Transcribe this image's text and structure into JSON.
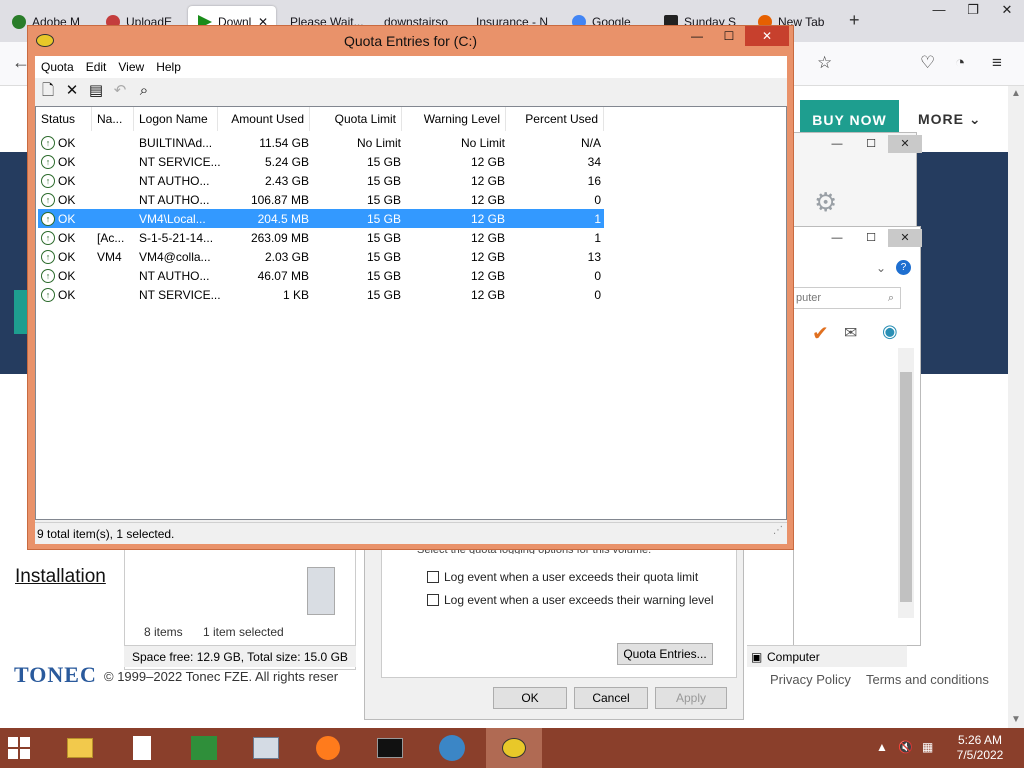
{
  "browser": {
    "tabs": [
      {
        "label": "Adobe M",
        "color": "#2a7d2a"
      },
      {
        "label": "UploadE",
        "color": "#c43d3d"
      },
      {
        "label": "Downl",
        "color": "#1a8c1a"
      },
      {
        "label": "Please Wait...",
        "color": "#9aa"
      },
      {
        "label": "downstairso",
        "color": "#9aa"
      },
      {
        "label": "Insurance - N",
        "color": "#9aa"
      },
      {
        "label": "Google",
        "color": "#4285f4"
      },
      {
        "label": "Sunday S",
        "color": "#222"
      },
      {
        "label": "New Tab",
        "color": "#e66000"
      }
    ],
    "new_tab_icon": "plus-icon"
  },
  "web": {
    "buy_now": "BUY NOW",
    "more": "MORE",
    "installation": "Installation",
    "brand": "TONEC",
    "copyright": "© 1999–2022 Tonec FZE. All rights reser",
    "privacy": "Privacy Policy",
    "terms": "Terms and conditions"
  },
  "explorer": {
    "items_count": "8 items",
    "selected": "1 item selected",
    "space": "Space free: 12.9 GB, Total size: 15.0 GB"
  },
  "properties": {
    "logging_caption": "Select the quota logging options for this volume:",
    "log_limit": "Log event when a user exceeds their quota limit",
    "log_warning": "Log event when a user exceeds their warning level",
    "quota_entries_button": "Quota Entries...",
    "ok": "OK",
    "cancel": "Cancel",
    "apply": "Apply"
  },
  "right_window": {
    "search_placeholder": "puter",
    "computer": "Computer"
  },
  "quota": {
    "title": "Quota Entries for  (C:)",
    "menu": [
      "Quota",
      "Edit",
      "View",
      "Help"
    ],
    "columns": [
      "Status",
      "Na...",
      "Logon Name",
      "Amount Used",
      "Quota Limit",
      "Warning Level",
      "Percent Used"
    ],
    "rows": [
      {
        "status": "OK",
        "name": "",
        "logon": "BUILTIN\\Ad...",
        "used": "11.54 GB",
        "limit": "No Limit",
        "warning": "No Limit",
        "percent": "N/A"
      },
      {
        "status": "OK",
        "name": "",
        "logon": "NT SERVICE...",
        "used": "5.24 GB",
        "limit": "15 GB",
        "warning": "12 GB",
        "percent": "34"
      },
      {
        "status": "OK",
        "name": "",
        "logon": "NT AUTHO...",
        "used": "2.43 GB",
        "limit": "15 GB",
        "warning": "12 GB",
        "percent": "16"
      },
      {
        "status": "OK",
        "name": "",
        "logon": "NT AUTHO...",
        "used": "106.87 MB",
        "limit": "15 GB",
        "warning": "12 GB",
        "percent": "0"
      },
      {
        "status": "OK",
        "name": "",
        "logon": "VM4\\Local...",
        "used": "204.5 MB",
        "limit": "15 GB",
        "warning": "12 GB",
        "percent": "1",
        "selected": true
      },
      {
        "status": "OK",
        "name": "[Ac...",
        "logon": "S-1-5-21-14...",
        "used": "263.09 MB",
        "limit": "15 GB",
        "warning": "12 GB",
        "percent": "1"
      },
      {
        "status": "OK",
        "name": "VM4",
        "logon": "VM4@colla...",
        "used": "2.03 GB",
        "limit": "15 GB",
        "warning": "12 GB",
        "percent": "13"
      },
      {
        "status": "OK",
        "name": "",
        "logon": "NT AUTHO...",
        "used": "46.07 MB",
        "limit": "15 GB",
        "warning": "12 GB",
        "percent": "0"
      },
      {
        "status": "OK",
        "name": "",
        "logon": "NT SERVICE...",
        "used": "1 KB",
        "limit": "15 GB",
        "warning": "12 GB",
        "percent": "0"
      }
    ],
    "status_bar": "9 total item(s), 1 selected.",
    "selection_color": "#3399ff",
    "frame_color": "#e9926a"
  },
  "taskbar": {
    "time": "5:26 AM",
    "date": "7/5/2022",
    "color": "#8a3f2b"
  }
}
